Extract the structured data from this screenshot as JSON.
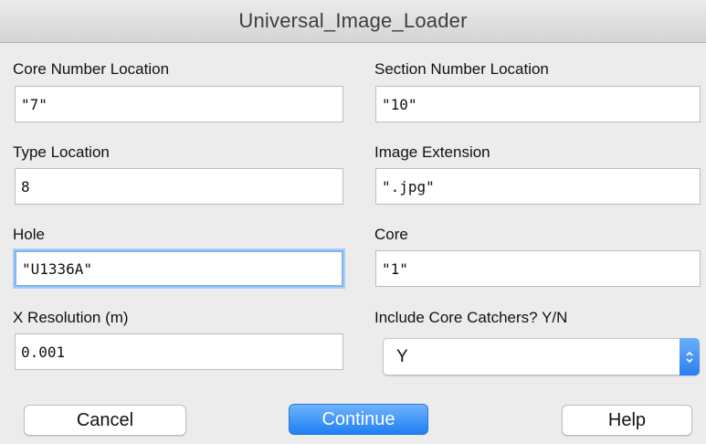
{
  "window": {
    "title": "Universal_Image_Loader"
  },
  "fields": {
    "core_number_location": {
      "label": "Core Number Location",
      "value": "\"7\""
    },
    "section_number_location": {
      "label": "Section Number Location",
      "value": "\"10\""
    },
    "type_location": {
      "label": "Type Location",
      "value": "8"
    },
    "image_extension": {
      "label": "Image Extension",
      "value": "\".jpg\""
    },
    "hole": {
      "label": "Hole",
      "value": "\"U1336A\""
    },
    "core": {
      "label": "Core",
      "value": "\"1\""
    },
    "x_resolution": {
      "label": "X Resolution (m)",
      "value": "0.001"
    },
    "include_core_catchers": {
      "label": "Include Core Catchers? Y/N",
      "value": "Y"
    }
  },
  "buttons": {
    "cancel": "Cancel",
    "continue": "Continue",
    "help": "Help"
  },
  "colors": {
    "accent": "#2a7ef0",
    "focus_ring": "#7fb4ee",
    "background": "#ececec"
  },
  "icons": {
    "select_arrow": "chevron-up-down-icon"
  }
}
